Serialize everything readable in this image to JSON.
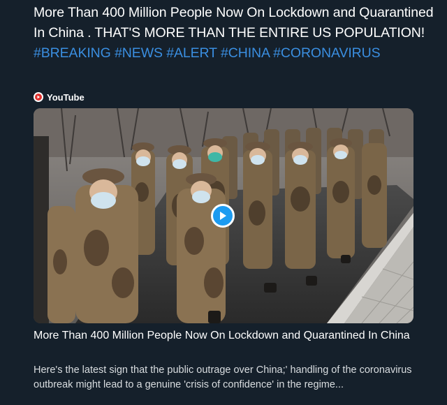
{
  "tweet": {
    "text_plain": "More Than 400 Million People Now On Lockdown and Quarantined In China . THAT'S MORE THAN THE ENTIRE US POPULATION! ",
    "hashtags": [
      "#BREAKING",
      "#NEWS",
      "#ALERT",
      "#CHINA",
      "#CORONAVIRUS"
    ]
  },
  "card": {
    "source": "YouTube",
    "title": "More Than 400 Million People Now On Lockdown and Quarantined In China",
    "description": "Here's the latest sign that the public outrage over China;' handling of the coronavirus outbreak might lead to a genuine 'crisis of confidence' in the regime..."
  },
  "colors": {
    "background": "#15202b",
    "text": "#ffffff",
    "hashtag": "#3a8ee0",
    "play_button": "#1d9bf0",
    "youtube_red": "#e0312e"
  },
  "icons": {
    "source_icon": "youtube-icon",
    "play_icon": "play-icon"
  }
}
